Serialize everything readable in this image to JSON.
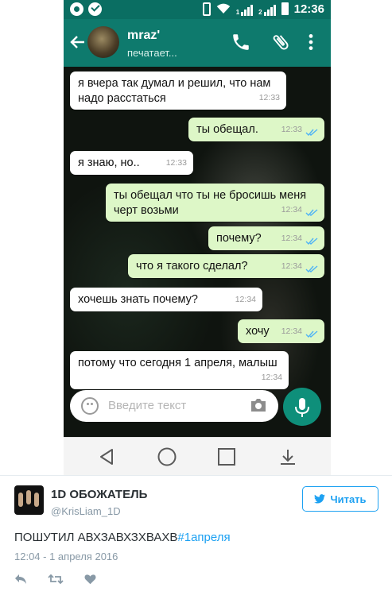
{
  "status_bar": {
    "time": "12:36",
    "sim1": "1",
    "sim2": "2"
  },
  "chat_header": {
    "contact_name": "mraz'",
    "status": "печатает..."
  },
  "messages": [
    {
      "dir": "in",
      "text": "я вчера так думал и решил, что нам надо расстаться",
      "time": "12:33"
    },
    {
      "dir": "out",
      "text": "ты обещал.",
      "time": "12:33"
    },
    {
      "dir": "in",
      "text": "я знаю, но..",
      "time": "12:33"
    },
    {
      "dir": "out",
      "text": "ты обещал что ты не бросишь меня черт возьми",
      "time": "12:34"
    },
    {
      "dir": "out",
      "text": "почему?",
      "time": "12:34"
    },
    {
      "dir": "out",
      "text": "что я такого сделал?",
      "time": "12:34"
    },
    {
      "dir": "in",
      "text": "хочешь знать почему?",
      "time": "12:34"
    },
    {
      "dir": "out",
      "text": "хочу",
      "time": "12:34"
    },
    {
      "dir": "in",
      "text": "потому что сегодня 1 апреля, малыш",
      "time": "12:34"
    }
  ],
  "composer": {
    "placeholder": "Введите текст"
  },
  "colors": {
    "header": "#0e7a6d",
    "outgoing": "#ddf7c7",
    "incoming": "#ffffff",
    "twitter_blue": "#1da1f2"
  },
  "tweet": {
    "name": "1D ОБОЖАТЕЛЬ",
    "handle": "@KrisLiam_1D",
    "follow_label": "Читать",
    "text": "ПОШУТИЛ АВХЗАВХЗХВАХВ",
    "hashtag": "#1апреля",
    "date": "12:04 - 1 апреля 2016"
  }
}
